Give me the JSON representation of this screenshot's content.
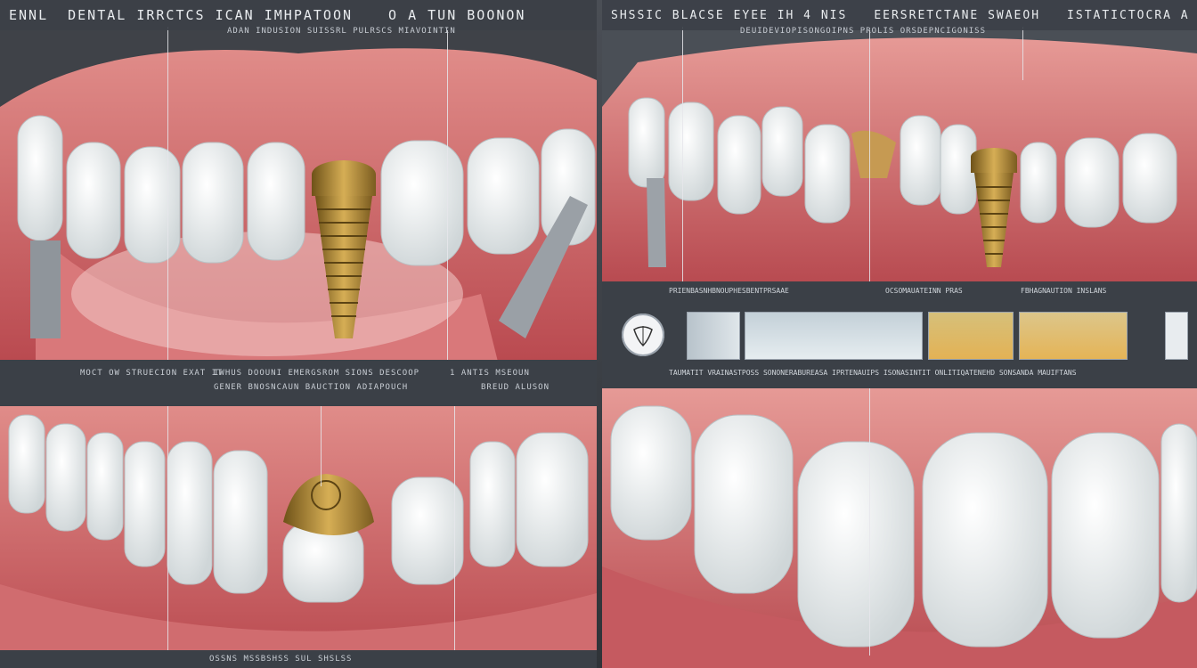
{
  "panels": {
    "top_left": {
      "title_left": "ENNL",
      "title_main": "DENTAL IRRCTCS ICAN IMHPATOON",
      "title_right": "O A TUN BOONON",
      "subtitle": "ADAN INDUSION SUISSRL PULRSCS MIAVOINTIN",
      "caption_left": "MOCT OW STRUECION EXAT IT",
      "caption_mid": "IWHUS DOOUNI EMERGSROM SIONS DESCOOP",
      "caption_mid2": "GENER BNOSNCAUN BAUCTION ADIAPOUCH",
      "caption_right": "1 ANTIS MSEOUN",
      "caption_right2": "BREUD ALUSON"
    },
    "top_right": {
      "title_left": "SHSSIC BLACSE EYEE IH 4 NIS",
      "title_mid": "EERSRETCTANE SWAEOH",
      "title_right": "ISTATICTOCRA A",
      "subtitle": "DEUIDEVIOPISONGOIPNS PROLIS ORSDEPNCIGONISS",
      "strip_label_1": "PRIENBASNHBNOUPHESBENTPRSAAE",
      "strip_label_2": "OCSOMAUATEINN PRAS",
      "strip_label_3": "FBHAGNAUTION INSLANS",
      "strip_caption": "TAUMATIT VRAINASTPOSS SONONERABUREASA IPRTENAUIPS ISONASINTIT ONLITIQATENEHD SONSANDA MAUIFTANS"
    },
    "bottom_left": {
      "caption": "OSSNS MSSBSHSS SUL SHSLSS"
    }
  },
  "colors": {
    "gum": "#c95a5e",
    "gum_light": "#e79a97",
    "tooth": "#f2f4f3",
    "implant_gold": "#b08a3e",
    "band": "#3b4047"
  },
  "icons": [
    "tooth-diagram-icon"
  ]
}
